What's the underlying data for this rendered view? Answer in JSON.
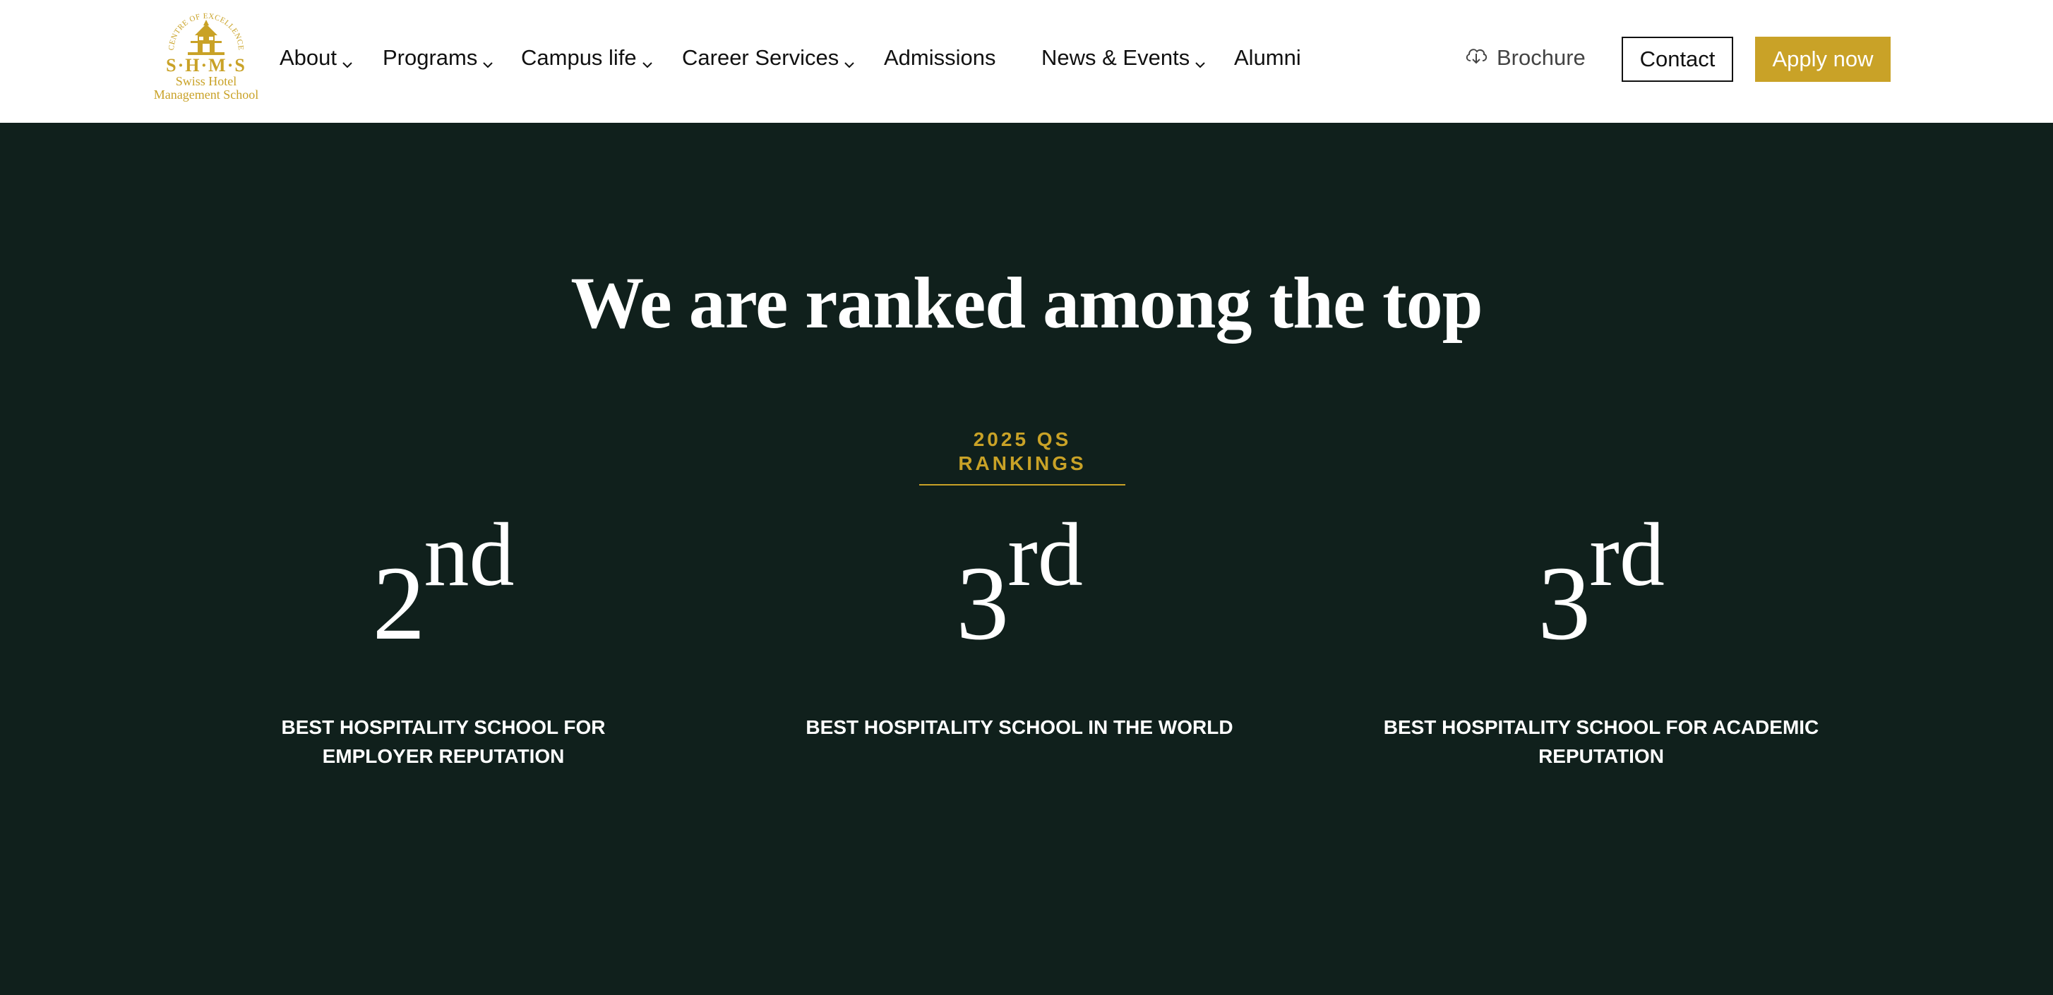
{
  "header": {
    "logo": {
      "arc_text": "CENTRE OF EXCELLENCE",
      "mark": "S·H·M·S",
      "line1": "Swiss Hotel",
      "line2": "Management School"
    },
    "nav": [
      {
        "label": "About",
        "has_dropdown": true
      },
      {
        "label": "Programs",
        "has_dropdown": true
      },
      {
        "label": "Campus life",
        "has_dropdown": true
      },
      {
        "label": "Career Services",
        "has_dropdown": true
      },
      {
        "label": "Admissions",
        "has_dropdown": false
      },
      {
        "label": "News & Events",
        "has_dropdown": true
      },
      {
        "label": "Alumni",
        "has_dropdown": false
      }
    ],
    "brochure_label": "Brochure",
    "contact_label": "Contact",
    "apply_label": "Apply now"
  },
  "rankings": {
    "title": "We are ranked among the top",
    "eyebrow": "2025 QS RANKINGS",
    "items": [
      {
        "number": "2",
        "suffix": "nd",
        "label": "BEST HOSPITALITY SCHOOL FOR EMPLOYER REPUTATION"
      },
      {
        "number": "3",
        "suffix": "rd",
        "label": "BEST HOSPITALITY SCHOOL IN THE WORLD"
      },
      {
        "number": "3",
        "suffix": "rd",
        "label": "BEST HOSPITALITY SCHOOL FOR ACADEMIC REPUTATION"
      }
    ]
  },
  "colors": {
    "brand_gold": "#c9a227",
    "section_background": "#10201c",
    "header_background": "#ffffff",
    "text_dark": "#111111"
  },
  "icons": {
    "brochure": "cloud-download-icon",
    "dropdown": "chevron-down-icon"
  }
}
